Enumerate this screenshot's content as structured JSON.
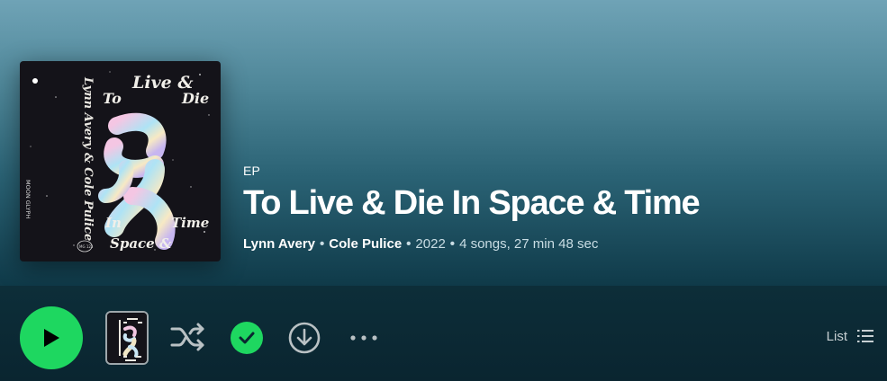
{
  "album": {
    "type": "EP",
    "title": "To Live & Die In Space & Time",
    "artists": [
      "Lynn Avery",
      "Cole Pulice"
    ],
    "year": "2022",
    "stats": "4 songs, 27 min 48 sec",
    "cover_text": {
      "line1": "Live &",
      "line2a": "To",
      "line2b": "Die",
      "line3a": "In",
      "line3b": "Time",
      "line4": "Space &",
      "side_artists": "Lynn Avery & Cole Pulice",
      "label": "MOON GLYPH",
      "catalog": "MG 123"
    }
  },
  "controls": {
    "view_label": "List"
  },
  "colors": {
    "accent": "#1ed760",
    "hero_top": "#6fa3b6",
    "hero_bottom": "#0f3a49",
    "background": "#0a2730"
  },
  "icons": {
    "play": "play-icon",
    "shuffle": "shuffle-icon",
    "saved": "check-icon",
    "download": "download-icon",
    "more": "more-icon",
    "list": "list-icon"
  }
}
